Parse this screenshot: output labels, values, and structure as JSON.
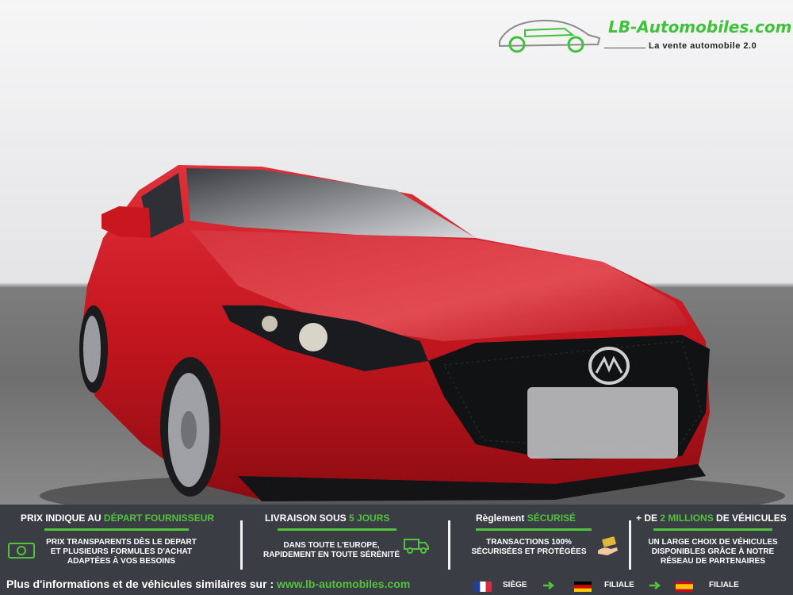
{
  "logo": {
    "title": "LB-Automobiles.com",
    "subtitle": "La vente automobile 2.0"
  },
  "colors": {
    "accent": "#53c23d",
    "bar_bg": "#3a3d44",
    "car_red": "#c4161f"
  },
  "features": [
    {
      "head_prefix": "PRIX INDIQUE AU ",
      "head_highlight": "DÉPART FOURNISSEUR",
      "head_suffix": "",
      "lines": [
        "PRIX TRANSPARENTS DÈS LE DEPART",
        "ET PLUSIEURS FORMULES D'ACHAT",
        "ADAPTÉES À VOS BESOINS"
      ],
      "icon": "money-icon"
    },
    {
      "head_prefix": "LIVRAISON SOUS ",
      "head_highlight": "5 JOURS",
      "head_suffix": "",
      "lines": [
        "DANS TOUTE L'EUROPE,",
        "RAPIDEMENT EN TOUTE SÉRÉNITÉ"
      ],
      "icon": "delivery-truck-icon"
    },
    {
      "head_prefix": "Règlement ",
      "head_highlight": "SÉCURISÉ",
      "head_suffix": "",
      "lines": [
        "TRANSACTIONS 100%",
        "SÉCURISÉES ET PROTÉGÉES"
      ],
      "icon": "payment-hand-icon"
    },
    {
      "head_prefix": "+ DE ",
      "head_highlight": "2 MILLIONS",
      "head_suffix": " DE VÉHICULES",
      "lines": [
        "UN LARGE CHOIX DE VÉHICULES",
        "DISPONIBLES GRÂCE À NOTRE",
        "RÉSEAU DE PARTENAIRES"
      ],
      "icon": ""
    }
  ],
  "footer": {
    "text": "Plus d'informations et de véhicules similaires sur : ",
    "url": "www.lb-automobiles.com",
    "locations": [
      {
        "country": "France",
        "label": "SIÈGE"
      },
      {
        "country": "Germany",
        "label": "FILIALE"
      },
      {
        "country": "Spain",
        "label": "FILIALE"
      }
    ]
  }
}
